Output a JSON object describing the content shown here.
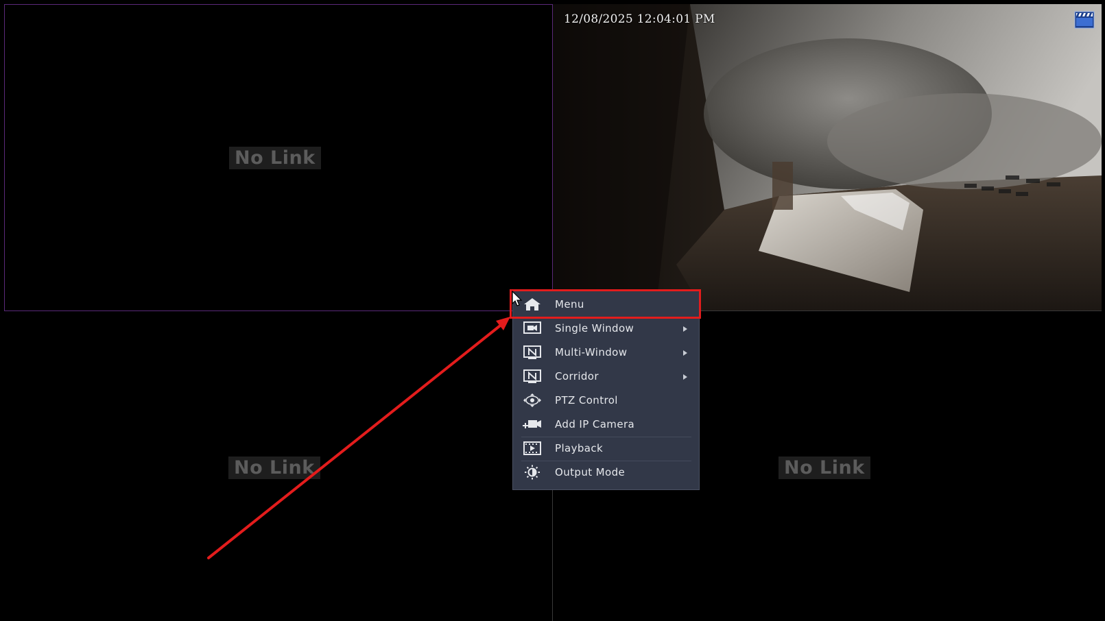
{
  "panes": [
    {
      "id": 1,
      "status": "No Link"
    },
    {
      "id": 2,
      "timestamp": "12/08/2025 12:04:01 PM",
      "record_icon": "clapperboard-icon"
    },
    {
      "id": 3,
      "status": "No Link"
    },
    {
      "id": 4,
      "status": "No Link"
    }
  ],
  "context_menu": {
    "items": [
      {
        "label": "Menu",
        "icon": "home-icon",
        "submenu": false
      },
      {
        "label": "Single Window",
        "icon": "single-window-icon",
        "submenu": true
      },
      {
        "label": "Multi-Window",
        "icon": "multi-window-icon",
        "submenu": true
      },
      {
        "label": "Corridor",
        "icon": "corridor-icon",
        "submenu": true
      },
      {
        "label": "PTZ Control",
        "icon": "ptz-icon",
        "submenu": false
      },
      {
        "label": "Add IP Camera",
        "icon": "add-camera-icon",
        "submenu": false
      },
      {
        "label": "Playback",
        "icon": "playback-icon",
        "submenu": false
      },
      {
        "label": "Output Mode",
        "icon": "output-mode-icon",
        "submenu": false
      }
    ]
  },
  "annotation": {
    "highlight_color": "#e31c1c",
    "highlighted_item": "Menu"
  },
  "colors": {
    "menu_background": "#323848",
    "pane_border_active": "#5b2a7a",
    "no_link_text": "#5c5c5c"
  }
}
